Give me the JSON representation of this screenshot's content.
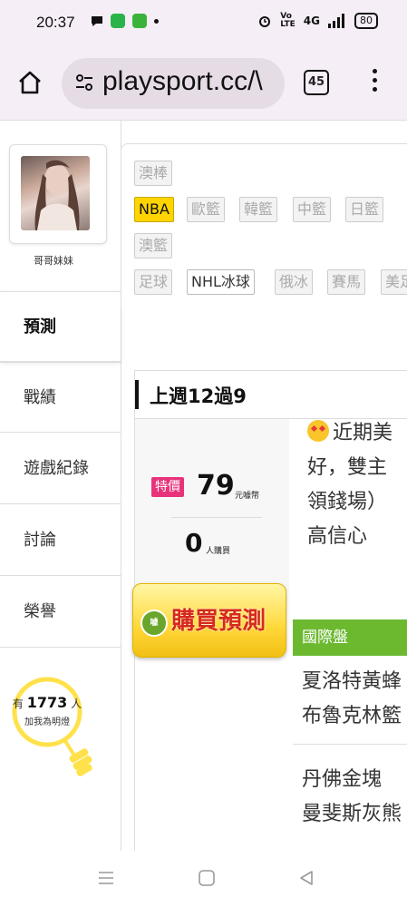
{
  "status_bar": {
    "time": "20:37",
    "battery": "80",
    "network": "4G"
  },
  "browser": {
    "url": "playsport.cc/\\",
    "tab_count": "45"
  },
  "profile": {
    "username": "哥哥妹妹"
  },
  "sidebar": {
    "items": [
      {
        "label": "預測"
      },
      {
        "label": "戰績"
      },
      {
        "label": "遊戲紀錄"
      },
      {
        "label": "討論"
      },
      {
        "label": "榮譽"
      }
    ]
  },
  "followers": {
    "prefix": "有",
    "count": "1773",
    "suffix": "人",
    "caption": "加我為明燈"
  },
  "leagues": {
    "row1": [
      "澳棒"
    ],
    "row2": [
      "NBA",
      "歐籃",
      "韓籃",
      "中籃",
      "日籃"
    ],
    "row3": [
      "澳籃"
    ],
    "row4": [
      "足球",
      "NHL冰球",
      "俄冰",
      "賽馬",
      "美足"
    ]
  },
  "record": {
    "title": "上週12過9"
  },
  "pricing": {
    "tag": "特價",
    "price": "79",
    "unit": "元噱幣",
    "buyers": "0",
    "buyers_unit": "人購買",
    "buy_button": "購買預測",
    "buy_icon_text": "噱"
  },
  "analysis": {
    "lines": [
      "近期美",
      "好，雙主",
      "領錢場）",
      "高信心"
    ]
  },
  "market": {
    "label": "國際盤",
    "games": [
      [
        "夏洛特黃蜂",
        "布魯克林籃"
      ],
      [
        "丹佛金塊",
        "曼斐斯灰熊"
      ]
    ]
  }
}
